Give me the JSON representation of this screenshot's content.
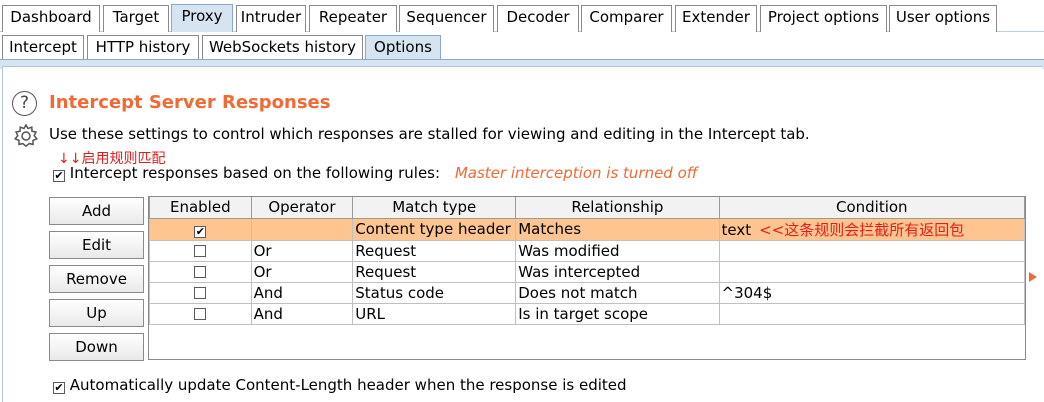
{
  "main_tabs": [
    {
      "label": "Dashboard"
    },
    {
      "label": "Target"
    },
    {
      "label": "Proxy",
      "active": true
    },
    {
      "label": "Intruder"
    },
    {
      "label": "Repeater"
    },
    {
      "label": "Sequencer"
    },
    {
      "label": "Decoder"
    },
    {
      "label": "Comparer"
    },
    {
      "label": "Extender"
    },
    {
      "label": "Project options"
    },
    {
      "label": "User options"
    }
  ],
  "sub_tabs": [
    {
      "label": "Intercept"
    },
    {
      "label": "HTTP history"
    },
    {
      "label": "WebSockets history"
    },
    {
      "label": "Options",
      "active": true
    }
  ],
  "section": {
    "help_icon": "?",
    "title": "Intercept Server Responses",
    "description": "Use these settings to control which responses are stalled for viewing and editing in the Intercept tab.",
    "annotation": "↓↓启用规则匹配",
    "rule_checkbox_checked": true,
    "rule_checkbox_label": "Intercept responses based on the following rules:",
    "warning": "Master interception is turned off"
  },
  "buttons": {
    "add": "Add",
    "edit": "Edit",
    "remove": "Remove",
    "up": "Up",
    "down": "Down"
  },
  "table": {
    "headers": [
      "Enabled",
      "Operator",
      "Match type",
      "Relationship",
      "Condition"
    ],
    "rows": [
      {
        "enabled": true,
        "operator": "",
        "match_type": "Content type header",
        "relationship": "Matches",
        "condition": "text",
        "annotation": "<<这条规则会拦截所有返回包",
        "selected": true
      },
      {
        "enabled": false,
        "operator": "Or",
        "match_type": "Request",
        "relationship": "Was modified",
        "condition": ""
      },
      {
        "enabled": false,
        "operator": "Or",
        "match_type": "Request",
        "relationship": "Was intercepted",
        "condition": ""
      },
      {
        "enabled": false,
        "operator": "And",
        "match_type": "Status code",
        "relationship": "Does not match",
        "condition": "^304$"
      },
      {
        "enabled": false,
        "operator": "And",
        "match_type": "URL",
        "relationship": "Is in target scope",
        "condition": ""
      }
    ]
  },
  "footer": {
    "checkbox_checked": true,
    "label": "Automatically update Content-Length header when the response is edited"
  },
  "colors": {
    "accent": "#f06a35",
    "selected_row": "#ffc591",
    "active_tab": "#d6e3f1",
    "annotation": "#e02020"
  }
}
